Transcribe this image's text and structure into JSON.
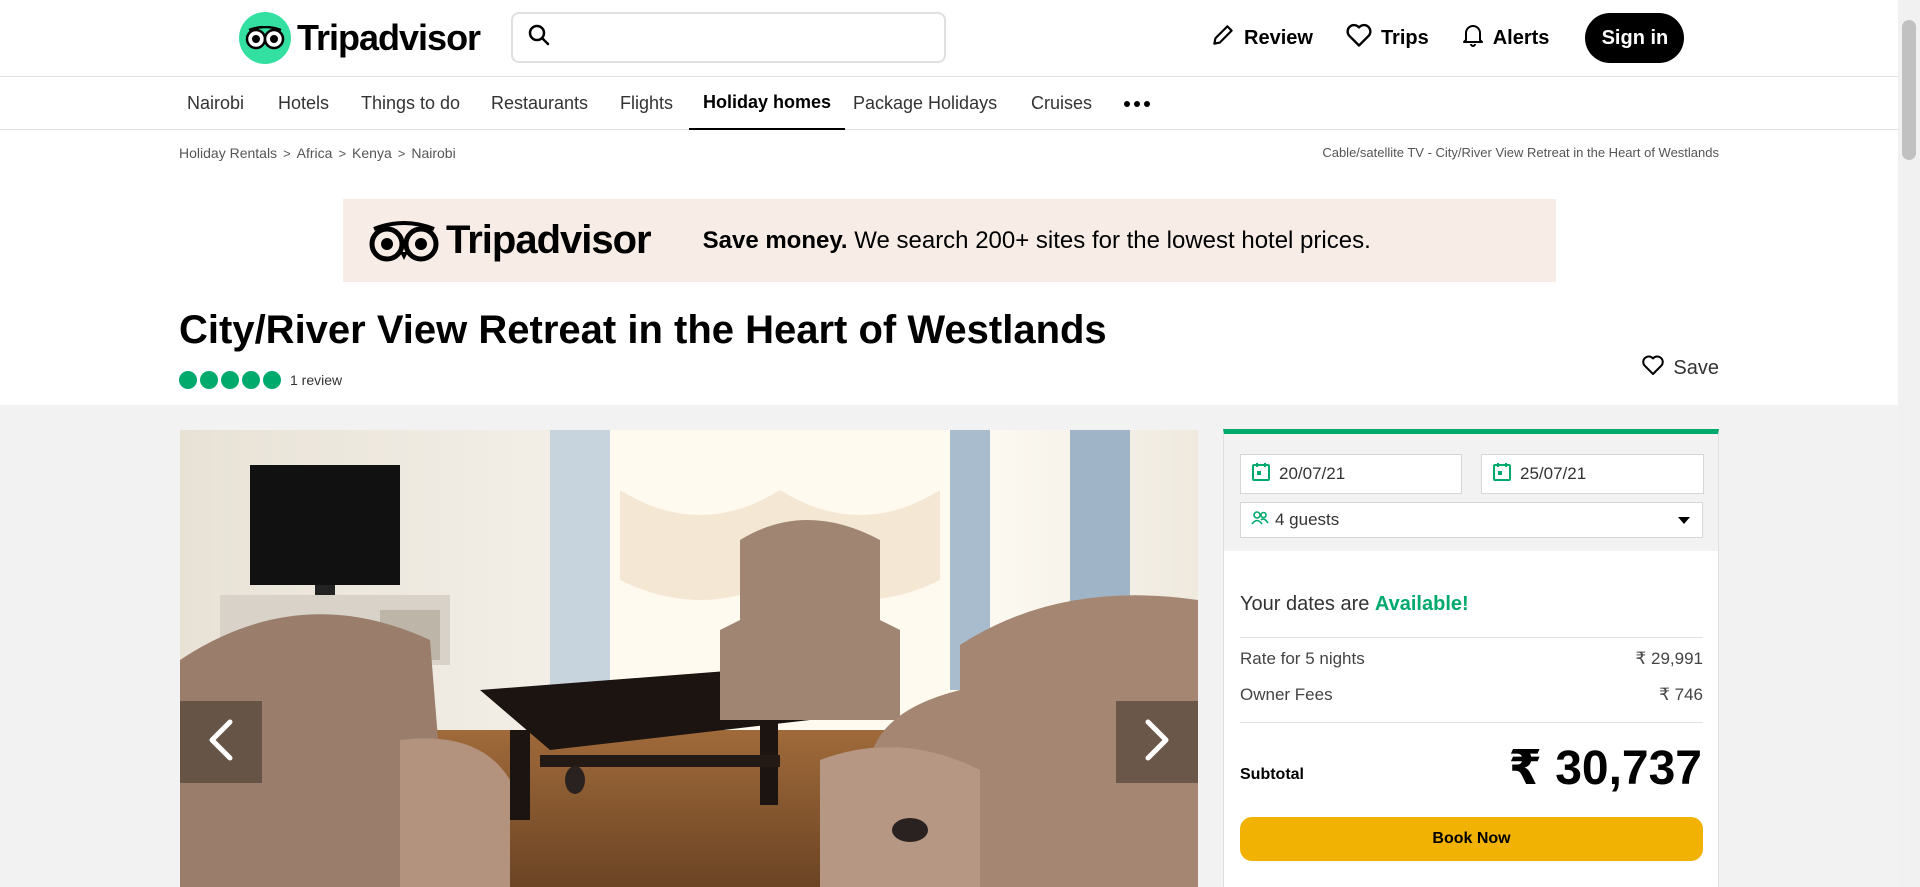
{
  "header": {
    "brand": "Tripadvisor",
    "search_placeholder": "",
    "actions": [
      {
        "label": "Review",
        "icon": "pencil-icon"
      },
      {
        "label": "Trips",
        "icon": "heart-icon"
      },
      {
        "label": "Alerts",
        "icon": "bell-icon"
      }
    ],
    "signin_label": "Sign in"
  },
  "nav": {
    "items": [
      "Nairobi",
      "Hotels",
      "Things to do",
      "Restaurants",
      "Flights",
      "Holiday homes",
      "Package Holidays",
      "Cruises"
    ],
    "active": "Holiday homes"
  },
  "breadcrumb": {
    "items": [
      "Holiday Rentals",
      "Africa",
      "Kenya",
      "Nairobi"
    ],
    "right_text": "Cable/satellite TV - City/River View Retreat in the Heart of Westlands"
  },
  "banner": {
    "brand": "Tripadvisor",
    "bold_text": "Save money.",
    "text": " We search 200+ sites for the lowest hotel prices."
  },
  "listing": {
    "title": "City/River View Retreat in the Heart of Westlands",
    "rating_bubbles": 5,
    "reviews_label": "1 review",
    "save_label": "Save"
  },
  "booking": {
    "checkin": "20/07/21",
    "checkout": "25/07/21",
    "guests": "4 guests",
    "availability_prefix": "Your dates are ",
    "availability_status": "Available!",
    "rate_label": "Rate for 5 nights",
    "rate_value": "₹ 29,991",
    "fees_label": "Owner Fees",
    "fees_value": "₹ 746",
    "subtotal_label": "Subtotal",
    "subtotal_value": "₹ 30,737",
    "book_label": "Book Now"
  },
  "colors": {
    "brand_green": "#34e0a1",
    "accent_green": "#00aa6c",
    "book_button": "#f2b203",
    "banner_bg": "#f8ede6"
  }
}
